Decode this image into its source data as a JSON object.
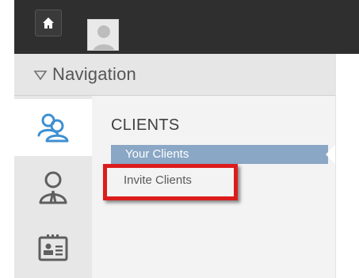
{
  "nav": {
    "header_label": "Navigation"
  },
  "menu": {
    "section_title": "CLIENTS",
    "items": [
      {
        "label": "Your Clients",
        "active": true
      },
      {
        "label": "Invite Clients",
        "active": false
      }
    ]
  },
  "icons": {
    "home": "home-icon",
    "avatar": "user-avatar",
    "nav_toggle": "triangle-down-icon",
    "rail": [
      "clients-group-icon",
      "consultant-icon",
      "id-card-icon"
    ]
  },
  "colors": {
    "topbar": "#2f2f2f",
    "active_item": "#8aa7c5",
    "highlight": "#dc1c1c",
    "rail_icon_active": "#3d8fd1",
    "rail_icon": "#5f5f5f"
  }
}
